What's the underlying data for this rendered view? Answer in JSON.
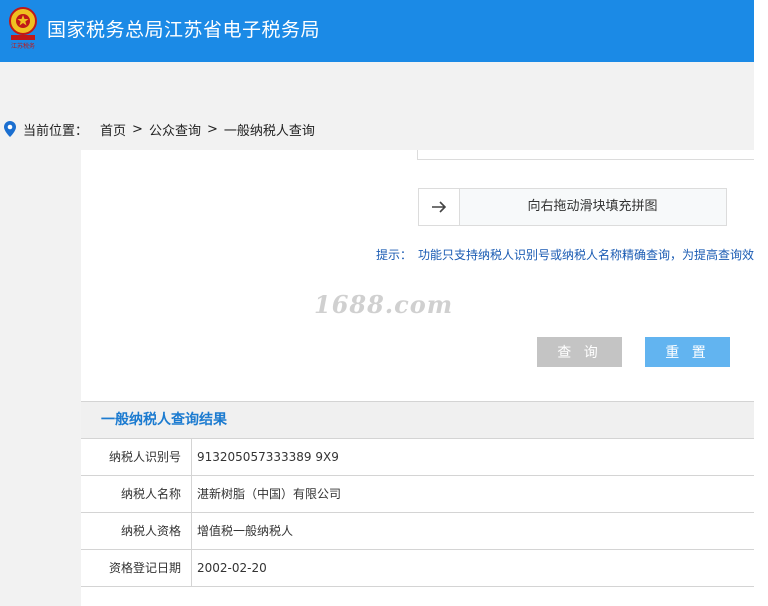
{
  "header": {
    "title": "国家税务总局江苏省电子税务局",
    "logo_caption": "江苏税务",
    "logo_icon": "tax-emblem-icon"
  },
  "breadcrumb": {
    "label": "当前位置：",
    "items": [
      "首页",
      "公众查询",
      "一般纳税人查询"
    ],
    "separator": ">"
  },
  "form": {
    "slider_text": "向右拖动滑块填充拼图",
    "hint_label": "提示：",
    "hint_text": "功能只支持纳税人识别号或纳税人名称精确查询，为提高查询效",
    "query_button": "查 询",
    "reset_button": "重 置"
  },
  "watermark": "1688.com",
  "results": {
    "title": "一般纳税人查询结果",
    "rows": [
      {
        "label": "纳税人识别号",
        "value": "913205057333389 9X9"
      },
      {
        "label": "纳税人名称",
        "value": "湛新树脂（中国）有限公司"
      },
      {
        "label": "纳税人资格",
        "value": "增值税一般纳税人"
      },
      {
        "label": "资格登记日期",
        "value": "2002-02-20"
      }
    ]
  },
  "colors": {
    "header_bg": "#1b8ae6",
    "result_title": "#1c7bd0",
    "query_button": "#c4c4c4",
    "reset_button": "#62b4f0"
  }
}
